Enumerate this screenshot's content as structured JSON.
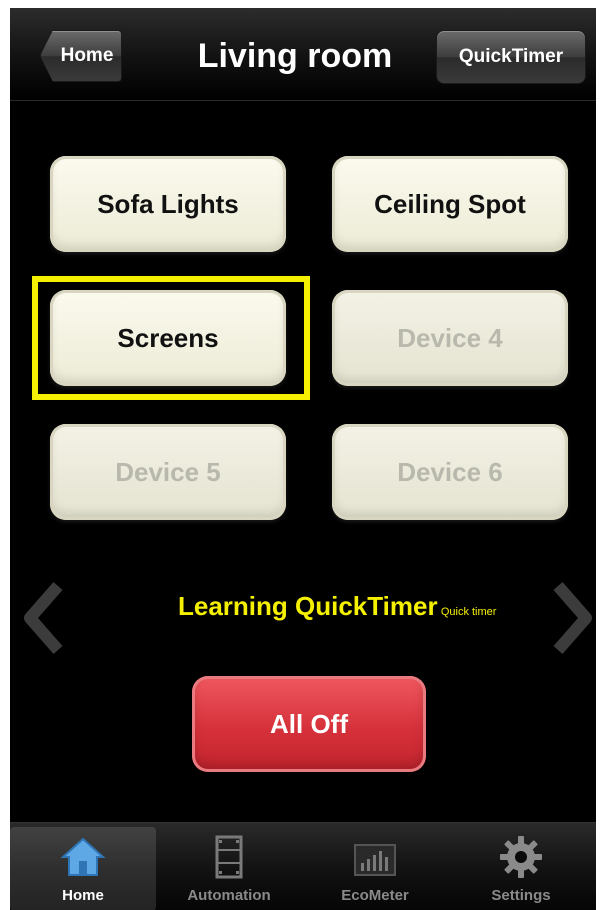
{
  "header": {
    "back_label": "Home",
    "title": "Living room",
    "right_button_label": "QuickTimer"
  },
  "devices": [
    {
      "label": "Sofa Lights",
      "enabled": true
    },
    {
      "label": "Ceiling Spot",
      "enabled": true
    },
    {
      "label": "Screens",
      "enabled": true,
      "highlighted": true
    },
    {
      "label": "Device 4",
      "enabled": false
    },
    {
      "label": "Device 5",
      "enabled": false
    },
    {
      "label": "Device 6",
      "enabled": false
    }
  ],
  "annotation": {
    "text": "Learning QuickTimer",
    "small_text": "Quick timer",
    "color": "#f5f000"
  },
  "pager": {
    "prev_icon": "chevron-left-icon",
    "next_icon": "chevron-right-icon"
  },
  "all_off_label": "All Off",
  "tabs": [
    {
      "label": "Home",
      "icon": "house-icon",
      "active": true
    },
    {
      "label": "Automation",
      "icon": "film-strip-icon",
      "active": false
    },
    {
      "label": "EcoMeter",
      "icon": "bar-meter-icon",
      "active": false
    },
    {
      "label": "Settings",
      "icon": "gear-icon",
      "active": false
    }
  ],
  "colors": {
    "background": "#000000",
    "button_face": "#f5f4e4",
    "disabled_text": "#b9b8ad",
    "alloff_red": "#d6313b",
    "highlight_yellow": "#f5f000",
    "tab_active": "#ffffff"
  }
}
